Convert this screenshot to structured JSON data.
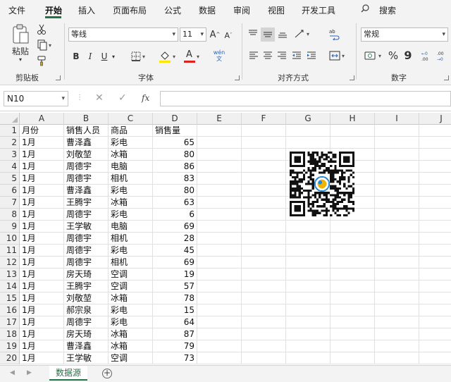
{
  "menu": {
    "tabs": [
      "文件",
      "开始",
      "插入",
      "页面布局",
      "公式",
      "数据",
      "审阅",
      "视图",
      "开发工具"
    ],
    "active": "开始",
    "search_label": "搜索"
  },
  "ribbon": {
    "clipboard": {
      "paste_label": "粘贴",
      "group_label": "剪贴板"
    },
    "font": {
      "font_name": "等线",
      "font_size": "11",
      "bold": "B",
      "italic": "I",
      "underline": "U",
      "grow": "A",
      "shrink": "A",
      "font_color_letter": "A",
      "phonetic": "wén 文",
      "group_label": "字体"
    },
    "alignment": {
      "group_label": "对齐方式"
    },
    "number": {
      "format": "常规",
      "percent": "%",
      "comma": "9",
      "group_label": "数字"
    }
  },
  "formula_bar": {
    "name_box": "N10",
    "fx": "fx",
    "value": ""
  },
  "columns": [
    "A",
    "B",
    "C",
    "D",
    "E",
    "F",
    "G",
    "H",
    "I",
    "J"
  ],
  "rows": [
    {
      "n": "1",
      "a": "月份",
      "b": "销售人员",
      "c": "商品",
      "d": "销售量"
    },
    {
      "n": "2",
      "a": "1月",
      "b": "曹泽鑫",
      "c": "彩电",
      "d": "65"
    },
    {
      "n": "3",
      "a": "1月",
      "b": "刘敬堃",
      "c": "冰箱",
      "d": "80"
    },
    {
      "n": "4",
      "a": "1月",
      "b": "周德宇",
      "c": "电脑",
      "d": "86"
    },
    {
      "n": "5",
      "a": "1月",
      "b": "周德宇",
      "c": "相机",
      "d": "83"
    },
    {
      "n": "6",
      "a": "1月",
      "b": "曹泽鑫",
      "c": "彩电",
      "d": "80"
    },
    {
      "n": "7",
      "a": "1月",
      "b": "王腾宇",
      "c": "冰箱",
      "d": "63"
    },
    {
      "n": "8",
      "a": "1月",
      "b": "周德宇",
      "c": "彩电",
      "d": "6"
    },
    {
      "n": "9",
      "a": "1月",
      "b": "王学敏",
      "c": "电脑",
      "d": "69"
    },
    {
      "n": "10",
      "a": "1月",
      "b": "周德宇",
      "c": "相机",
      "d": "28"
    },
    {
      "n": "11",
      "a": "1月",
      "b": "周德宇",
      "c": "彩电",
      "d": "45"
    },
    {
      "n": "12",
      "a": "1月",
      "b": "周德宇",
      "c": "相机",
      "d": "69"
    },
    {
      "n": "13",
      "a": "1月",
      "b": "房天琦",
      "c": "空调",
      "d": "19"
    },
    {
      "n": "14",
      "a": "1月",
      "b": "王腾宇",
      "c": "空调",
      "d": "57"
    },
    {
      "n": "15",
      "a": "1月",
      "b": "刘敬堃",
      "c": "冰箱",
      "d": "78"
    },
    {
      "n": "16",
      "a": "1月",
      "b": "郝宗泉",
      "c": "彩电",
      "d": "15"
    },
    {
      "n": "17",
      "a": "1月",
      "b": "周德宇",
      "c": "彩电",
      "d": "64"
    },
    {
      "n": "18",
      "a": "1月",
      "b": "房天琦",
      "c": "冰箱",
      "d": "87"
    },
    {
      "n": "19",
      "a": "1月",
      "b": "曹泽鑫",
      "c": "冰箱",
      "d": "79"
    },
    {
      "n": "20",
      "a": "1月",
      "b": "王学敏",
      "c": "空调",
      "d": "73"
    }
  ],
  "sheets": {
    "active": "数据源",
    "add": "+"
  },
  "colors": {
    "accent": "#217346",
    "font_color_bar": "#e02020",
    "fill_color_bar": "#ffe600"
  }
}
